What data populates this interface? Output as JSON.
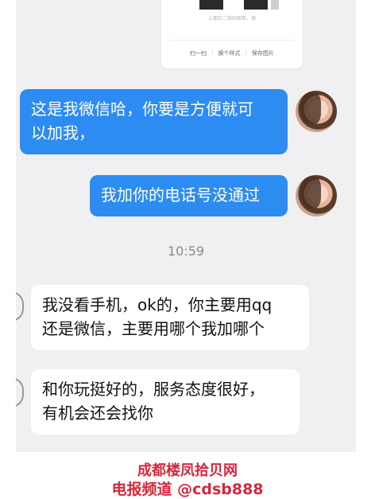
{
  "shared_card": {
    "note": "上面的二维码图案，保",
    "actions": [
      "扫一扫",
      "换个样式",
      "保存图片"
    ]
  },
  "messages": [
    {
      "direction": "outgoing",
      "lines": [
        "这是我微信哈，你要是方便就可",
        "以加我，"
      ]
    },
    {
      "direction": "outgoing",
      "lines": [
        "我加你的电话号没通过"
      ]
    },
    {
      "direction": "incoming",
      "lines": [
        "我没看手机，ok的，你主要用qq",
        "还是微信，主要用哪个我加哪个"
      ]
    },
    {
      "direction": "incoming",
      "lines": [
        "和你玩挺好的，服务态度很好，",
        "有机会还会找你"
      ]
    }
  ],
  "timestamp": "10:59",
  "watermark": {
    "line1": "成都楼凤拾贝网",
    "line2_cn": "电报频道 ",
    "line2_handle": "@cdsb888"
  },
  "colors": {
    "outgoing_bubble": "#2d8cf2",
    "incoming_bubble": "#ffffff",
    "chat_background": "#f0f0f2",
    "watermark": "#d7263d"
  }
}
